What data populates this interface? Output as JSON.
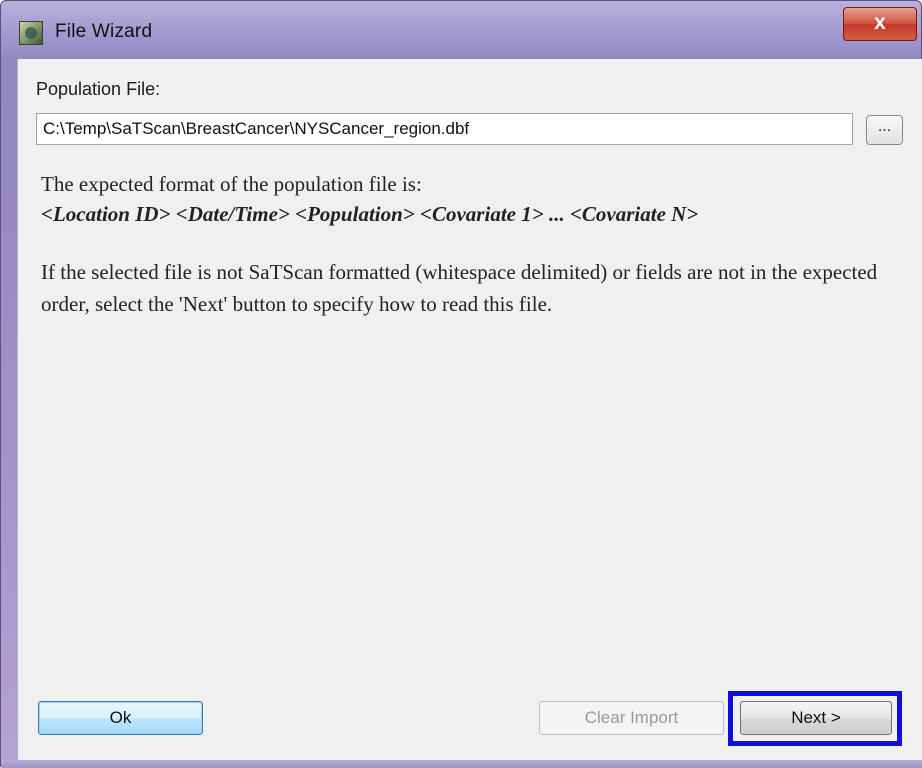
{
  "window": {
    "title": "File Wizard",
    "close_glyph": "x",
    "icon": "app-icon"
  },
  "form": {
    "population_label": "Population File:",
    "file_path": "C:\\Temp\\SaTScan\\BreastCancer\\NYSCancer_region.dbf",
    "browse_label": "..."
  },
  "info": {
    "expected_intro": "The expected format of the population file is:",
    "format_spec": "<Location ID> <Date/Time> <Population> <Covariate 1> ... <Covariate N>",
    "help_text": "If the selected file is not SaTScan formatted (whitespace delimited) or fields are not in the expected order, select the 'Next' button to specify how to read this file."
  },
  "buttons": {
    "ok": "Ok",
    "clear_import": "Clear Import",
    "next": "Next >"
  },
  "colors": {
    "highlight": "#1010d8",
    "titlebar": "#a79dd1",
    "close": "#c0372a"
  }
}
